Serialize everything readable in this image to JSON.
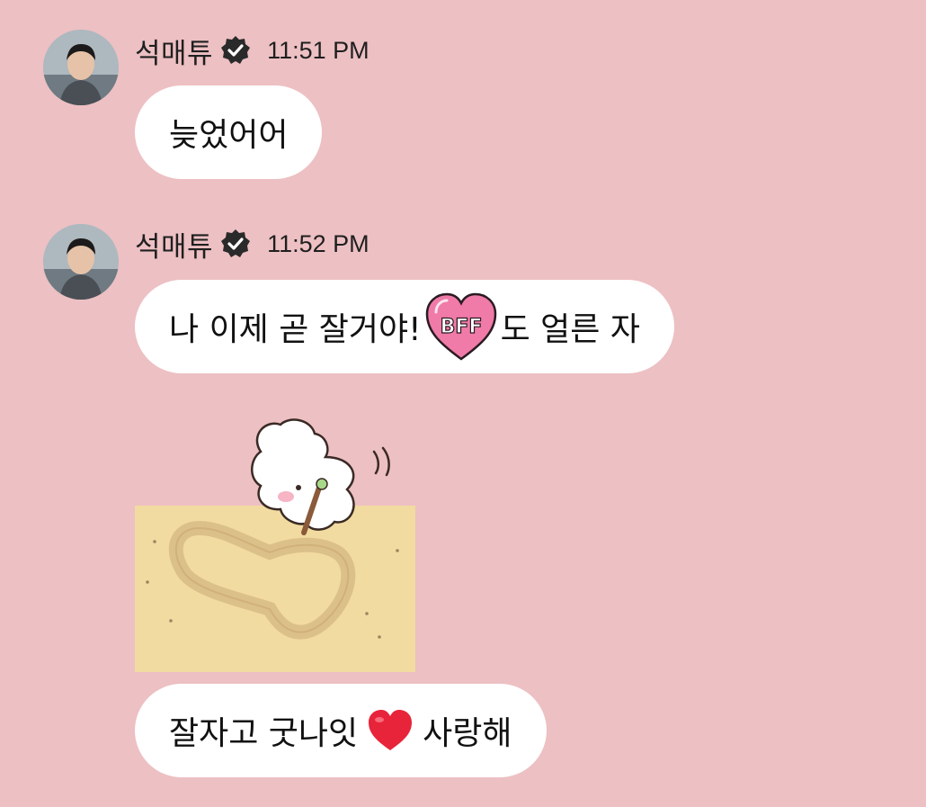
{
  "messages": [
    {
      "sender": "석매튜",
      "time": "11:51 PM",
      "text": "늦었어어"
    },
    {
      "sender": "석매튜",
      "time": "11:52 PM",
      "text_before_sticker": "나 이제 곧 잘거야!",
      "inline_sticker_text": "BFF",
      "text_after_sticker": "도 얼른 자"
    }
  ],
  "sticker": {
    "icon": "bunny-drawing-heart-in-sand-sticker"
  },
  "final_message": {
    "text_before": "잘자고 굿나잇",
    "emoji_icon": "red-heart-icon",
    "text_after": "사랑해"
  },
  "colors": {
    "background": "#edc0c3",
    "bubble": "#ffffff",
    "text": "#111111",
    "heart": "#e8243a",
    "sand": "#f2dba0"
  }
}
